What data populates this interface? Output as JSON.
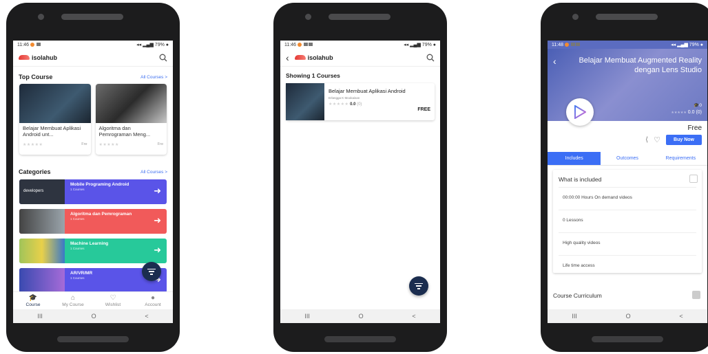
{
  "status": {
    "time1": "11:46",
    "time2": "11:46",
    "time3": "11:48",
    "battery": "79%"
  },
  "app": {
    "name": "isolahub"
  },
  "home": {
    "top_course_title": "Top Course",
    "all_courses_link": "All Courses >",
    "courses": [
      {
        "title": "Belajar Membuat Aplikasi Android unt...",
        "price": "Fre"
      },
      {
        "title": "Algoritma dan Pemrograman Meng...",
        "price": "Fre"
      }
    ],
    "categories_title": "Categories",
    "categories": [
      {
        "name": "Mobile Programing Android",
        "count": "1 Courses",
        "color": "#5a54e8"
      },
      {
        "name": "Algoritma dan Pemrograman",
        "count": "1 Courses",
        "color": "#f15a5a"
      },
      {
        "name": "Machine Learning",
        "count": "1 Courses",
        "color": "#27c99a"
      },
      {
        "name": "AR/VR/MR",
        "count": "1 Courses",
        "color": "#5a54e8"
      }
    ],
    "category_thumb_text": "developers",
    "nav": [
      "Course",
      "My Course",
      "Wishlist",
      "Account"
    ]
  },
  "search": {
    "showing": "Showing 1 Courses",
    "result": {
      "title": "Belajar Membuat Aplikasi Android",
      "author": "Erlangga K Mookaisan",
      "rating": "0.0",
      "reviews": "(0)",
      "price": "FREE"
    }
  },
  "detail": {
    "title": "Belajar Membuat Augmented Reality dengan Lens Studio",
    "students": "0",
    "rating": "0.0 (0)",
    "price": "Free",
    "buy_label": "Buy Now",
    "tabs": [
      "Includes",
      "Outcomes",
      "Requirements"
    ],
    "included_title": "What is included",
    "included": [
      "00:00:00 Hours On demand videos",
      "0 Lessons",
      "High quality videos",
      "Life time access"
    ],
    "curriculum_title": "Course Curriculum"
  },
  "sysnav": {
    "recent": "III",
    "home": "O",
    "back": "<"
  }
}
